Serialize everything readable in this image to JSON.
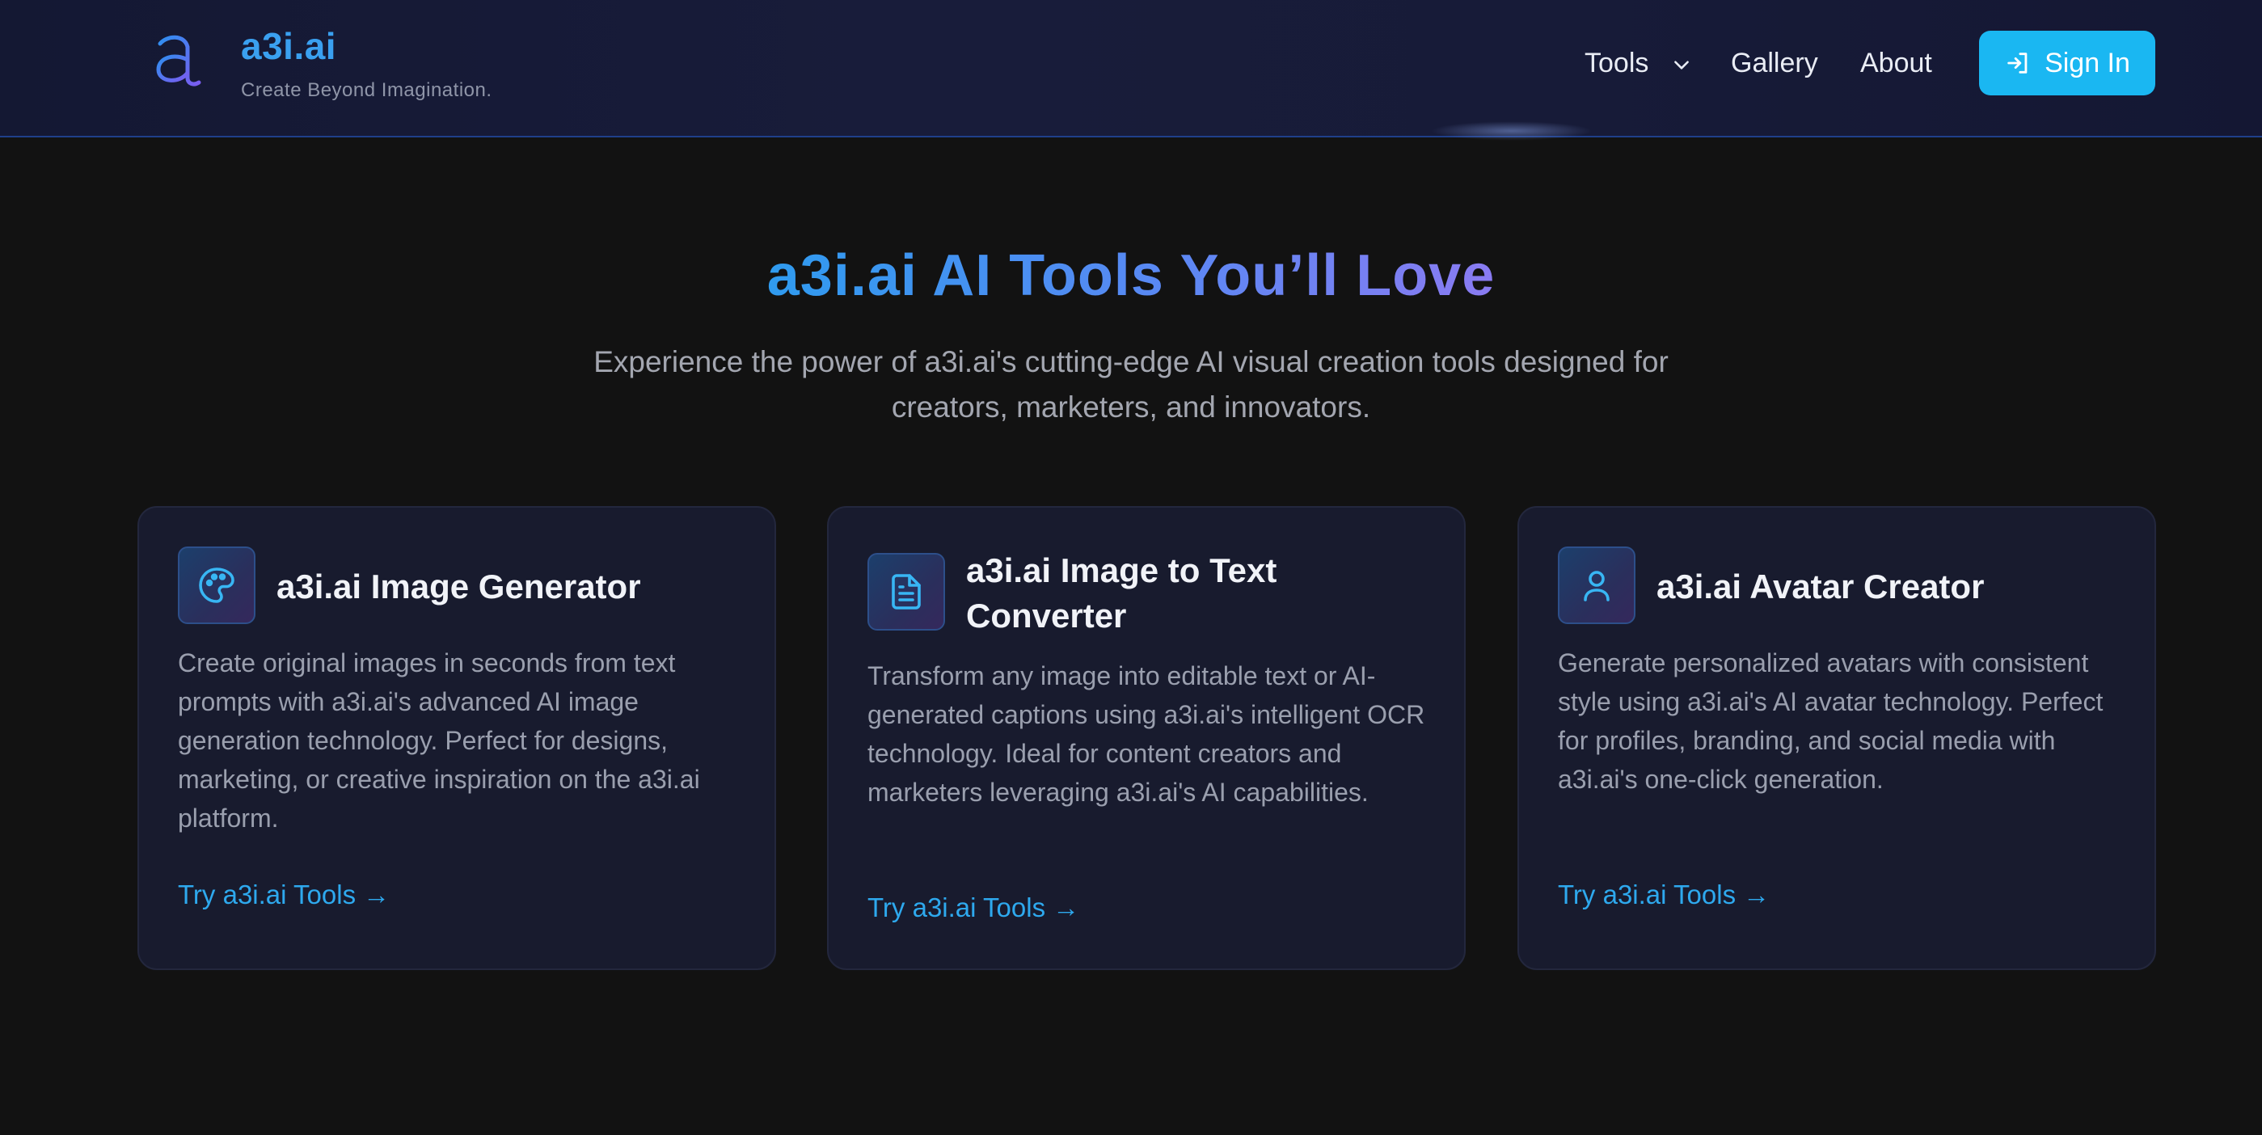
{
  "header": {
    "brand_name": "a3i.ai",
    "tagline": "Create Beyond Imagination.",
    "nav": {
      "tools": "Tools",
      "gallery": "Gallery",
      "about": "About"
    },
    "signin_label": "Sign In",
    "icons": [
      "logo-mark",
      "chevron-down-icon",
      "sign-in-icon"
    ]
  },
  "hero": {
    "title": "a3i.ai AI Tools You’ll Love",
    "subtitle_line1": "Experience the power of a3i.ai's cutting-edge AI visual creation tools designed for",
    "subtitle_line2": "creators, marketers, and innovators."
  },
  "cards": [
    {
      "icon": "palette-icon",
      "title": "a3i.ai Image Generator",
      "description": "Create original images in seconds from text prompts with a3i.ai's advanced AI image generation technology. Perfect for designs, marketing, or creative inspiration on the a3i.ai platform.",
      "link": "Try a3i.ai Tools →"
    },
    {
      "icon": "document-icon",
      "title": "a3i.ai Image to Text Converter",
      "description": "Transform any image into editable text or AI-generated captions using a3i.ai's intelligent OCR technology. Ideal for content creators and marketers leveraging a3i.ai's AI capabilities.",
      "link": "Try a3i.ai Tools →"
    },
    {
      "icon": "user-icon",
      "title": "a3i.ai Avatar Creator",
      "description": "Generate personalized avatars with consistent style using a3i.ai's AI avatar technology. Perfect for profiles, branding, and social media with a3i.ai's one-click generation.",
      "link": "Try a3i.ai Tools →"
    }
  ],
  "colors": {
    "background": "#121212",
    "header_bg": "#161a36",
    "accent": "#1ab7f2",
    "brand_blue": "#3aa0f0",
    "card_bg": "#181b2e",
    "link": "#2ea9ee"
  }
}
